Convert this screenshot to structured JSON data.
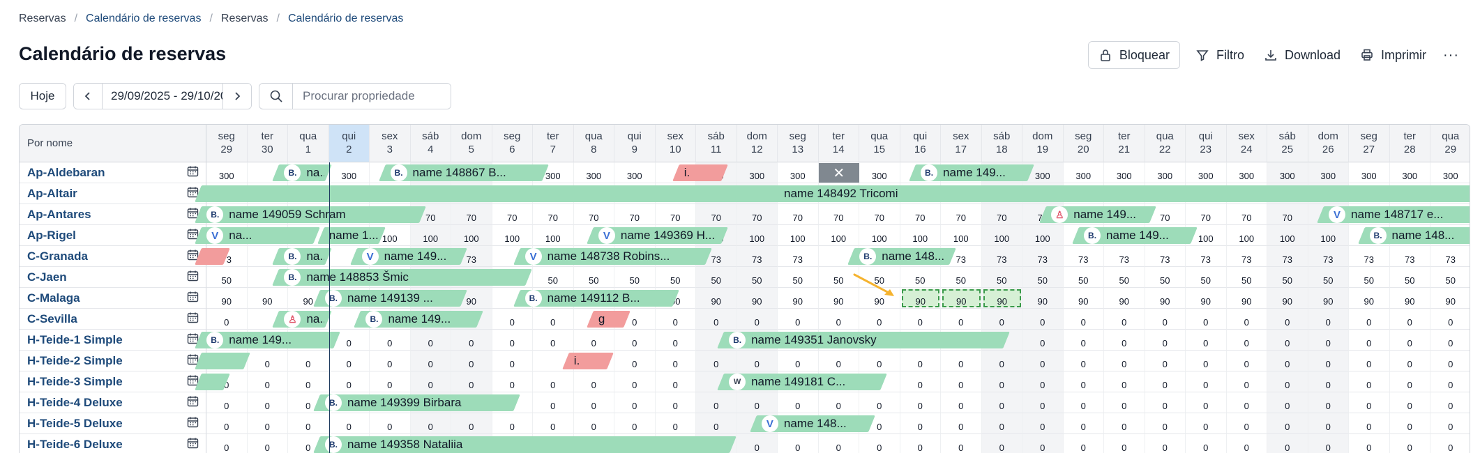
{
  "breadcrumb": [
    "Reservas",
    "Calendário de reservas",
    "Reservas",
    "Calendário de reservas"
  ],
  "page_title": "Calendário de reservas",
  "actions": {
    "lock": "Bloquear",
    "filter": "Filtro",
    "download": "Download",
    "print": "Imprimir",
    "more": "···"
  },
  "toolbar": {
    "today": "Hoje",
    "date_range": "29/09/2025 - 29/10/20...",
    "search_placeholder": "Procurar propriedade"
  },
  "grid": {
    "name_header": "Por nome",
    "today_index": 3,
    "days": [
      {
        "wd": "seg",
        "d": "29"
      },
      {
        "wd": "ter",
        "d": "30"
      },
      {
        "wd": "qua",
        "d": "1"
      },
      {
        "wd": "qui",
        "d": "2"
      },
      {
        "wd": "sex",
        "d": "3"
      },
      {
        "wd": "sáb",
        "d": "4"
      },
      {
        "wd": "dom",
        "d": "5"
      },
      {
        "wd": "seg",
        "d": "6"
      },
      {
        "wd": "ter",
        "d": "7"
      },
      {
        "wd": "qua",
        "d": "8"
      },
      {
        "wd": "qui",
        "d": "9"
      },
      {
        "wd": "sex",
        "d": "10"
      },
      {
        "wd": "sáb",
        "d": "11"
      },
      {
        "wd": "dom",
        "d": "12"
      },
      {
        "wd": "seg",
        "d": "13"
      },
      {
        "wd": "ter",
        "d": "14"
      },
      {
        "wd": "qua",
        "d": "15"
      },
      {
        "wd": "qui",
        "d": "16"
      },
      {
        "wd": "sex",
        "d": "17"
      },
      {
        "wd": "sáb",
        "d": "18"
      },
      {
        "wd": "dom",
        "d": "19"
      },
      {
        "wd": "seg",
        "d": "20"
      },
      {
        "wd": "ter",
        "d": "21"
      },
      {
        "wd": "qua",
        "d": "22"
      },
      {
        "wd": "qui",
        "d": "23"
      },
      {
        "wd": "sex",
        "d": "24"
      },
      {
        "wd": "sáb",
        "d": "25"
      },
      {
        "wd": "dom",
        "d": "26"
      },
      {
        "wd": "seg",
        "d": "27"
      },
      {
        "wd": "ter",
        "d": "28"
      },
      {
        "wd": "qua",
        "d": "29"
      }
    ],
    "rows": [
      {
        "name": "Ap-Aldebaran",
        "price": "300",
        "bookings": [
          {
            "s": 1.7,
            "e": 3.0,
            "src": "B",
            "label": "na..."
          },
          {
            "s": 4.3,
            "e": 8.3,
            "src": "B",
            "label": "name 148867 B..."
          },
          {
            "s": 11.5,
            "e": 12.7,
            "src": "",
            "label": "i.",
            "red": true
          },
          {
            "s": 17.3,
            "e": 20.2,
            "src": "B",
            "label": "name 149..."
          }
        ],
        "blocked": [
          15
        ],
        "hide": [
          1,
          2,
          5,
          6,
          7,
          11,
          17,
          18,
          19
        ]
      },
      {
        "name": "Ap-Altair",
        "price": "",
        "bookings": [
          {
            "s": -0.2,
            "e": 31.2,
            "src": "",
            "label": "name 148492 Tricomi",
            "center": true
          }
        ],
        "hide": []
      },
      {
        "name": "Ap-Antares",
        "price": "70",
        "bookings": [
          {
            "s": -0.2,
            "e": 5.3,
            "src": "B",
            "label": "name 149059 Schram"
          },
          {
            "s": 20.5,
            "e": 23.2,
            "src": "A",
            "label": "name 149..."
          },
          {
            "s": 27.3,
            "e": 31.2,
            "src": "V",
            "label": "name 148717 e..."
          }
        ],
        "hide": [
          0,
          1,
          2,
          3,
          4,
          21,
          22,
          27,
          28,
          29,
          30
        ]
      },
      {
        "name": "Ap-Rigel",
        "price": "100",
        "bookings": [
          {
            "s": -0.2,
            "e": 2.7,
            "src": "V",
            "label": "na..."
          },
          {
            "s": 2.8,
            "e": 4.3,
            "src": "",
            "label": "name 1..."
          },
          {
            "s": 9.4,
            "e": 12.7,
            "src": "V",
            "label": "name 149369 H..."
          },
          {
            "s": 21.3,
            "e": 24.2,
            "src": "B",
            "label": "name 149..."
          },
          {
            "s": 28.3,
            "e": 31.2,
            "src": "B",
            "label": "name 148..."
          }
        ],
        "hide": [
          0,
          1,
          2,
          3,
          9,
          10,
          11,
          21,
          22,
          23,
          28,
          29,
          30
        ]
      },
      {
        "name": "C-Granada",
        "price": "73",
        "bookings": [
          {
            "s": -0.2,
            "e": 0.5,
            "src": "",
            "label": "",
            "red": true
          },
          {
            "s": 1.7,
            "e": 3.0,
            "src": "B",
            "label": "na..."
          },
          {
            "s": 3.6,
            "e": 6.3,
            "src": "V",
            "label": "name 149..."
          },
          {
            "s": 7.6,
            "e": 12.3,
            "src": "V",
            "label": "name 148738 Robins..."
          },
          {
            "s": 15.8,
            "e": 18.3,
            "src": "B",
            "label": "name 148..."
          }
        ],
        "hide": [
          1,
          2,
          3,
          4,
          5,
          7,
          8,
          9,
          10,
          11,
          15,
          16,
          17
        ]
      },
      {
        "name": "C-Jaen",
        "price": "50",
        "bookings": [
          {
            "s": 1.7,
            "e": 7.9,
            "src": "B",
            "label": "name 148853 Šmic"
          }
        ],
        "hide": [
          1,
          2,
          3,
          4,
          5,
          6
        ]
      },
      {
        "name": "C-Malaga",
        "price": "90",
        "bookings": [
          {
            "s": 2.7,
            "e": 6.3,
            "src": "B",
            "label": "name 149139 ..."
          },
          {
            "s": 7.6,
            "e": 11.5,
            "src": "B",
            "label": "name 149112 B..."
          }
        ],
        "hide": [
          3,
          4,
          5,
          7,
          8,
          9,
          10
        ],
        "selected": [
          17,
          18,
          19
        ]
      },
      {
        "name": "C-Sevilla",
        "price": "0",
        "bookings": [
          {
            "s": 1.7,
            "e": 3.0,
            "src": "A",
            "label": "na..."
          },
          {
            "s": 3.7,
            "e": 6.7,
            "src": "B",
            "label": "name 149..."
          },
          {
            "s": 9.4,
            "e": 10.3,
            "src": "",
            "label": "g",
            "red": true
          }
        ],
        "hide": [
          1,
          2,
          3,
          4,
          5,
          9
        ]
      },
      {
        "name": "H-Teide-1 Simple",
        "price": "0",
        "bookings": [
          {
            "s": -0.2,
            "e": 3.2,
            "src": "B",
            "label": "name 149..."
          },
          {
            "s": 12.6,
            "e": 19.6,
            "src": "B",
            "label": "name 149351 Janovsky"
          }
        ],
        "hide": [
          0,
          1,
          2,
          12,
          13,
          14,
          15,
          16,
          17,
          18
        ]
      },
      {
        "name": "H-Teide-2 Simple",
        "price": "0",
        "bookings": [
          {
            "s": -0.2,
            "e": 1.0,
            "src": "",
            "label": ""
          },
          {
            "s": 8.8,
            "e": 9.9,
            "src": "",
            "label": "i.",
            "red": true
          }
        ],
        "hide": [
          0,
          8
        ]
      },
      {
        "name": "H-Teide-3 Simple",
        "price": "0",
        "bookings": [
          {
            "s": -0.2,
            "e": 0.5,
            "src": "",
            "label": ""
          },
          {
            "s": 12.6,
            "e": 16.6,
            "src": "W",
            "label": "name 149181 C..."
          }
        ],
        "hide": [
          12,
          13,
          14,
          15
        ]
      },
      {
        "name": "H-Teide-4 Deluxe",
        "price": "0",
        "bookings": [
          {
            "s": 2.7,
            "e": 7.6,
            "src": "B",
            "label": "name 149399 Birbara"
          }
        ],
        "hide": [
          3,
          4,
          5,
          6
        ]
      },
      {
        "name": "H-Teide-5 Deluxe",
        "price": "0",
        "bookings": [
          {
            "s": 13.4,
            "e": 16.3,
            "src": "V",
            "label": "name 148..."
          }
        ],
        "hide": [
          13,
          14,
          15
        ]
      },
      {
        "name": "H-Teide-6 Deluxe",
        "price": "0",
        "bookings": [
          {
            "s": 2.7,
            "e": 12.9,
            "src": "B",
            "label": "name 149358 Nataliia"
          }
        ],
        "hide": [
          3,
          4,
          5,
          6,
          7,
          8,
          9,
          10,
          11
        ]
      }
    ]
  }
}
